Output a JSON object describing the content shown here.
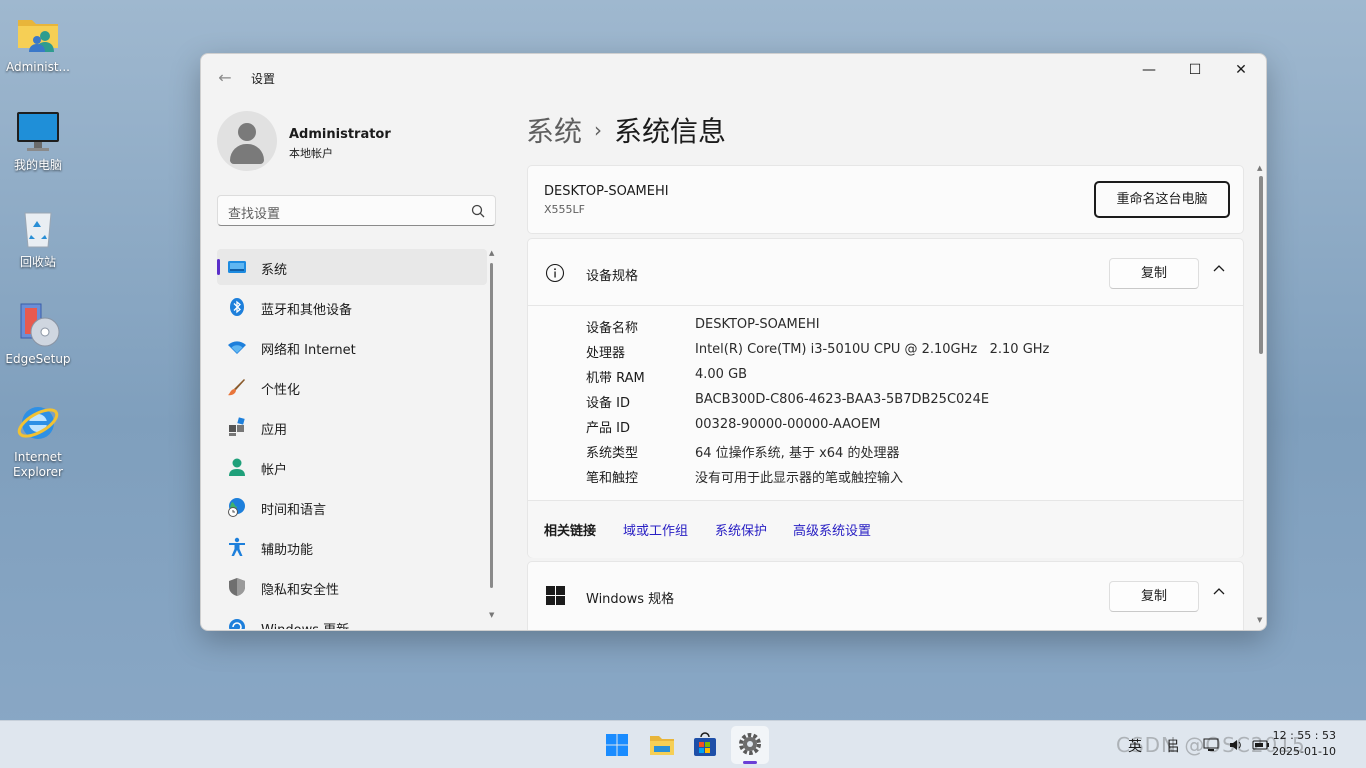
{
  "desktop": {
    "icons": [
      {
        "label": "Administ..."
      },
      {
        "label": "我的电脑"
      },
      {
        "label": "回收站"
      },
      {
        "label": "EdgeSetup"
      },
      {
        "label": "Internet Explorer"
      }
    ]
  },
  "window": {
    "title": "设置",
    "controls": {
      "minimize": "—",
      "maximize": "☐",
      "close": "✕"
    }
  },
  "profile": {
    "name": "Administrator",
    "type": "本地帐户"
  },
  "search": {
    "placeholder": "查找设置"
  },
  "nav": {
    "items": [
      {
        "label": "系统",
        "icon": "system-display-icon",
        "active": true
      },
      {
        "label": "蓝牙和其他设备",
        "icon": "bluetooth-icon"
      },
      {
        "label": "网络和 Internet",
        "icon": "wifi-icon"
      },
      {
        "label": "个性化",
        "icon": "brush-icon"
      },
      {
        "label": "应用",
        "icon": "apps-icon"
      },
      {
        "label": "帐户",
        "icon": "person-icon"
      },
      {
        "label": "时间和语言",
        "icon": "globe-clock-icon"
      },
      {
        "label": "辅助功能",
        "icon": "accessibility-icon"
      },
      {
        "label": "隐私和安全性",
        "icon": "shield-icon"
      },
      {
        "label": "Windows 更新",
        "icon": "update-icon"
      }
    ]
  },
  "breadcrumb": {
    "parent": "系统",
    "separator": "›",
    "current": "系统信息"
  },
  "pc": {
    "name": "DESKTOP-SOAMEHI",
    "model": "X555LF",
    "rename_label": "重命名这台电脑"
  },
  "device_specs": {
    "title": "设备规格",
    "copy_label": "复制",
    "rows": [
      {
        "key": "设备名称",
        "value": "DESKTOP-SOAMEHI"
      },
      {
        "key": "处理器",
        "value": "Intel(R) Core(TM) i3-5010U CPU @ 2.10GHz   2.10 GHz"
      },
      {
        "key": "机带 RAM",
        "value": "4.00 GB"
      },
      {
        "key": "设备 ID",
        "value": "BACB300D-C806-4623-BAA3-5B7DB25C024E"
      },
      {
        "key": "产品 ID",
        "value": "00328-90000-00000-AAOEM"
      },
      {
        "key": "系统类型",
        "value": "64 位操作系统, 基于 x64 的处理器"
      },
      {
        "key": "笔和触控",
        "value": "没有可用于此显示器的笔或触控输入"
      }
    ],
    "related_label": "相关链接",
    "related_links": [
      "域或工作组",
      "系统保护",
      "高级系统设置"
    ]
  },
  "windows_specs": {
    "title": "Windows 规格",
    "copy_label": "复制"
  },
  "taskbar": {
    "apps": [
      "start-icon",
      "file-explorer-icon",
      "store-icon",
      "settings-icon"
    ],
    "ime": "英",
    "ime2": "㠯",
    "time": "12 : 55 : 53",
    "date": "2025-01-10",
    "watermark": "CSDN @OSC2015"
  }
}
